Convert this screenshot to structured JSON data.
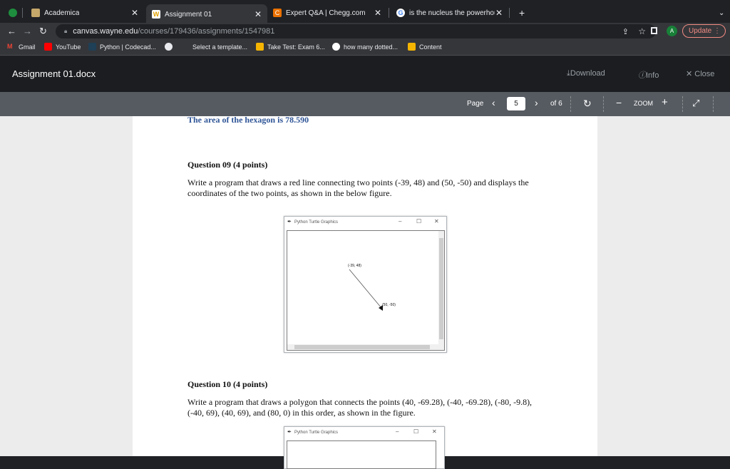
{
  "browser": {
    "tabs": [
      {
        "title": "Academica",
        "active": false
      },
      {
        "title": "Assignment 01",
        "active": true
      },
      {
        "title": "Expert Q&A | Chegg.com",
        "active": false
      },
      {
        "title": "is the nucleus the powerhouse",
        "active": false
      }
    ],
    "new_tab": "+",
    "url_host": "canvas.wayne.edu",
    "url_path": "/courses/179436/assignments/1547981",
    "profile_initial": "A",
    "update_label": "Update",
    "bookmarks": [
      "Gmail",
      "YouTube",
      "Python | Codecad...",
      "Select a template...",
      "Take Test: Exam 6...",
      "how many dotted...",
      "Content"
    ]
  },
  "viewer": {
    "doc_title": "Assignment 01.docx",
    "download": "Download",
    "info": "Info",
    "close": "Close",
    "page_label": "Page",
    "page_current": "5",
    "page_total": "of 6",
    "zoom_label": "ZOOM"
  },
  "document": {
    "hexagon_text": "The area of the hexagon is 78.590",
    "q9_heading": "Question 09 (4 points)",
    "q9_text": "Write a program that draws a red line connecting two points (-39, 48) and (50, -50) and displays the coordinates of the two points, as shown in the below figure.",
    "window_title": "Python Turtle Graphics",
    "point1_label": "(-39, 48)",
    "point2_label": "(50, -50)",
    "q10_heading": "Question 10 (4 points)",
    "q10_text": "Write a program that draws a polygon that connects the points (40, -69.28), (-40, -69.28), (-80, -9.8), (-40, 69), (40, 69), and (80, 0) in this order, as shown in the figure."
  },
  "colors": {
    "hexagon_text": "#2f5597",
    "update_button": "#f28b82",
    "avatar": "#188038"
  }
}
